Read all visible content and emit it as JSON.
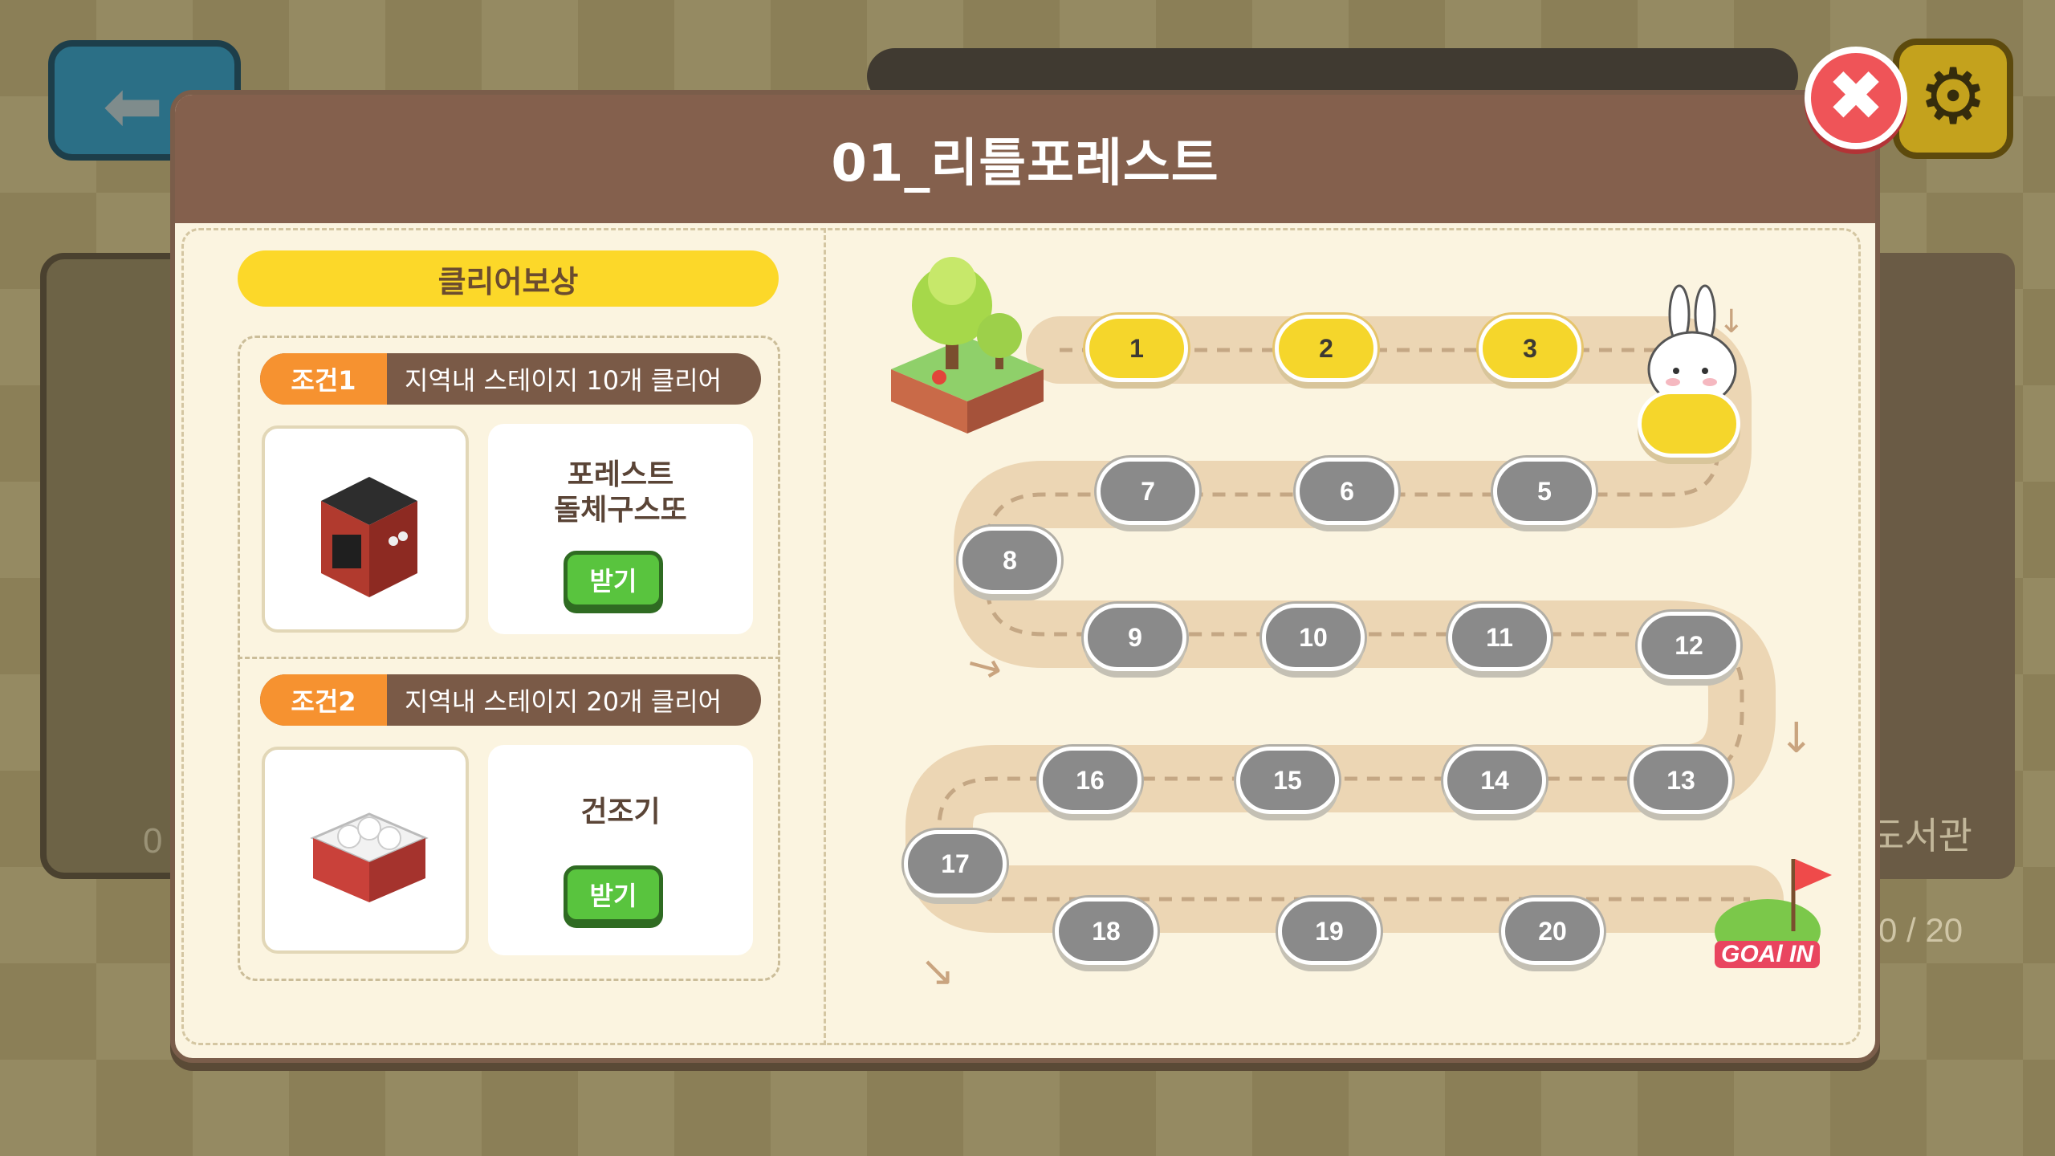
{
  "popup": {
    "title": "01_리틀포레스트"
  },
  "reward": {
    "title": "클리어보상",
    "conditions": [
      {
        "tag": "조건1",
        "text": "지역내 스테이지 10개 클리어",
        "item_name_line1": "포레스트",
        "item_name_line2": "돌체구스또",
        "button_label": "받기",
        "item_icon": "coffee-machine-icon"
      },
      {
        "tag": "조건2",
        "text": "지역내 스테이지 20개 클리어",
        "item_name_line1": "건조기",
        "item_name_line2": "",
        "button_label": "받기",
        "item_icon": "dryer-icon"
      }
    ]
  },
  "map": {
    "stages": [
      {
        "num": "1",
        "state": "cleared"
      },
      {
        "num": "2",
        "state": "cleared"
      },
      {
        "num": "3",
        "state": "cleared"
      },
      {
        "num": "",
        "state": "current"
      },
      {
        "num": "5",
        "state": "locked"
      },
      {
        "num": "6",
        "state": "locked"
      },
      {
        "num": "7",
        "state": "locked"
      },
      {
        "num": "8",
        "state": "locked"
      },
      {
        "num": "9",
        "state": "locked"
      },
      {
        "num": "10",
        "state": "locked"
      },
      {
        "num": "11",
        "state": "locked"
      },
      {
        "num": "12",
        "state": "locked"
      },
      {
        "num": "13",
        "state": "locked"
      },
      {
        "num": "14",
        "state": "locked"
      },
      {
        "num": "15",
        "state": "locked"
      },
      {
        "num": "16",
        "state": "locked"
      },
      {
        "num": "17",
        "state": "locked"
      },
      {
        "num": "18",
        "state": "locked"
      },
      {
        "num": "19",
        "state": "locked"
      },
      {
        "num": "20",
        "state": "locked"
      }
    ],
    "goal_label": "GOAl IN"
  },
  "background": {
    "right_card_label": "도서관",
    "right_card_count": "0 / 20",
    "left_card_label": "0"
  },
  "colors": {
    "header": "#84604d",
    "panel": "#fbf4e0",
    "cleared": "#f5d62b",
    "locked": "#8a8a8a",
    "accent_orange": "#f69230",
    "close_red": "#ef5458",
    "receive_green": "#59c43e"
  }
}
